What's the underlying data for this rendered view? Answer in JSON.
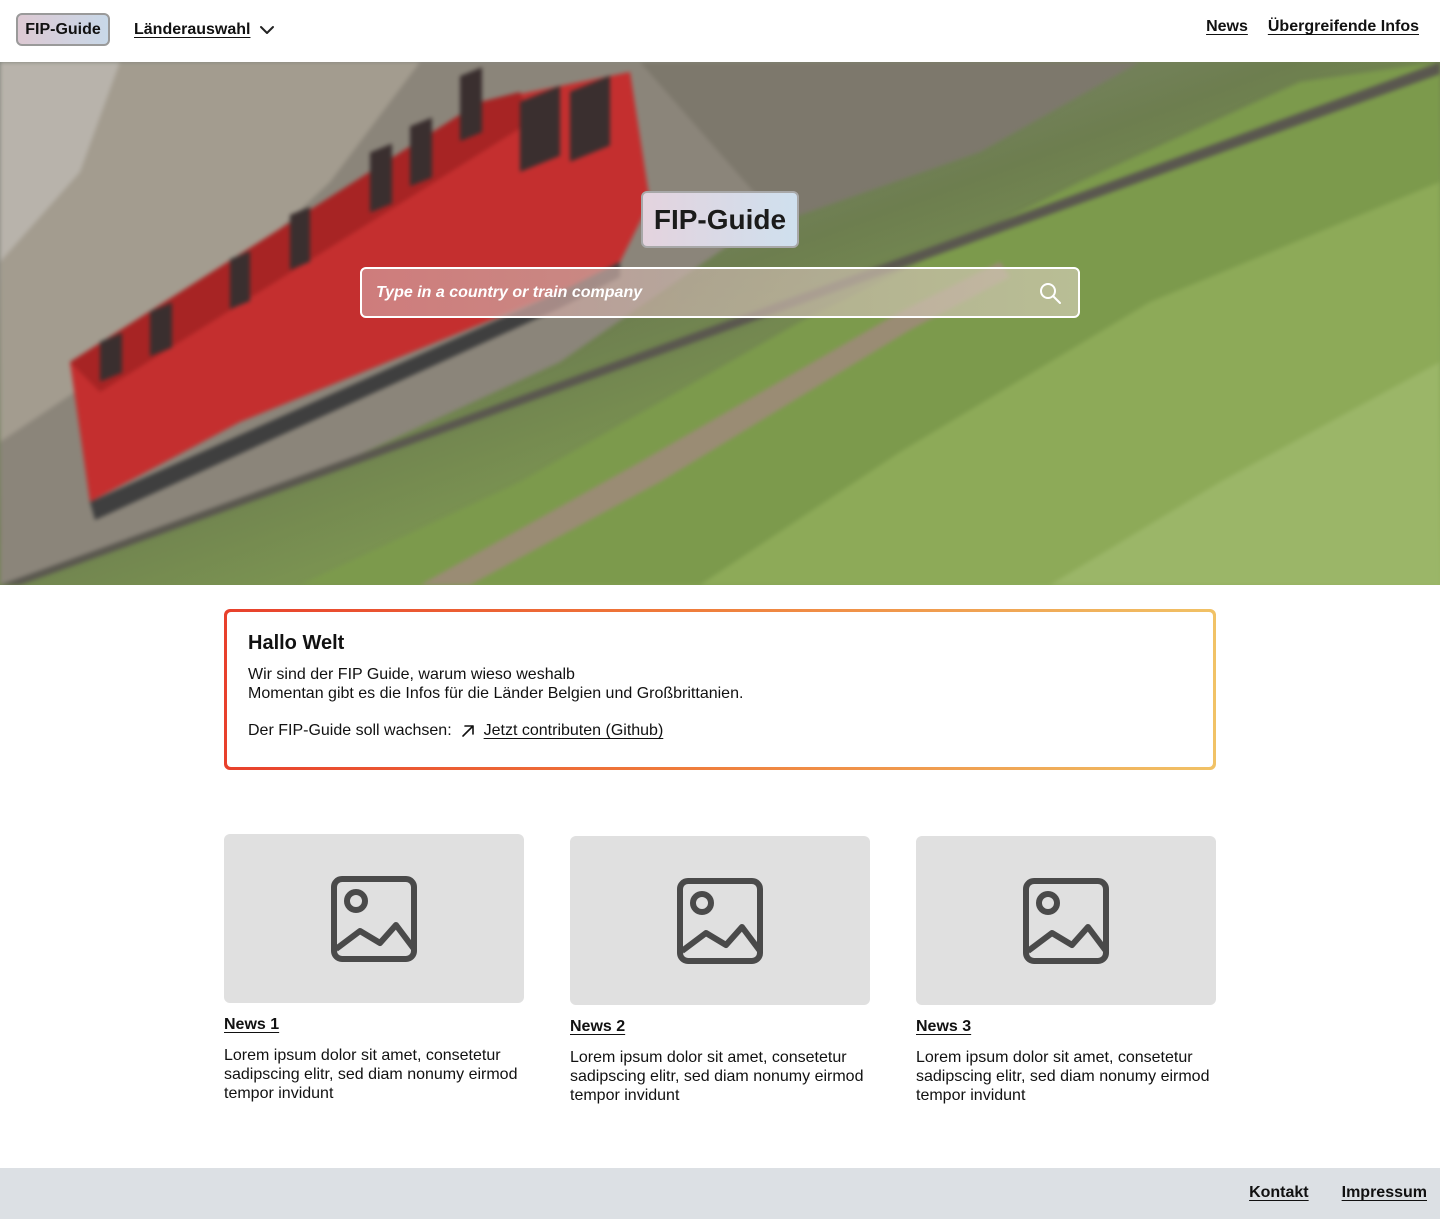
{
  "header": {
    "brand": "FIP-Guide",
    "country_select": "Länderauswahl",
    "nav": [
      "News",
      "Übergreifende Infos"
    ]
  },
  "hero": {
    "title": "FIP-Guide",
    "search_placeholder": "Type in a country or train company"
  },
  "intro": {
    "heading": "Hallo Welt",
    "line1": "Wir sind der FIP Guide, warum wieso weshalb",
    "line2": "Momentan gibt es die Infos für die Länder Belgien und Großbrittanien.",
    "contrib_prefix": "Der FIP-Guide soll wachsen:",
    "contrib_link": "Jetzt contributen (Github)"
  },
  "news": [
    {
      "title": "News 1",
      "text": "Lorem ipsum dolor sit amet, consetetur sadipscing elitr, sed diam nonumy eirmod tempor invidunt"
    },
    {
      "title": "News 2",
      "text": "Lorem ipsum dolor sit amet, consetetur sadipscing elitr, sed diam nonumy eirmod tempor invidunt"
    },
    {
      "title": "News 3",
      "text": "Lorem ipsum dolor sit amet, consetetur sadipscing elitr, sed diam nonumy eirmod tempor invidunt"
    }
  ],
  "footer": {
    "links": [
      "Kontakt",
      "Impressum"
    ]
  },
  "colors": {
    "intro_border_start": "#e8402c",
    "intro_border_end": "#f1c266",
    "thumb_bg": "#e0e0e0",
    "footer_bg": "#dce0e4"
  }
}
